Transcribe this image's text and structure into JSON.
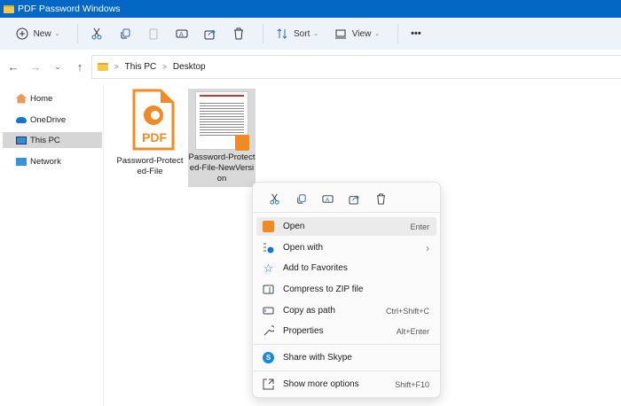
{
  "window": {
    "title": "PDF Password Windows"
  },
  "toolbar": {
    "new_label": "New",
    "sort_label": "Sort",
    "view_label": "View",
    "more": "•••"
  },
  "address": {
    "crumbs": [
      "This PC",
      "Desktop"
    ],
    "sep": ">"
  },
  "sidebar": {
    "items": [
      {
        "label": "Home"
      },
      {
        "label": "OneDrive"
      },
      {
        "label": "This PC"
      },
      {
        "label": "Network"
      }
    ]
  },
  "files": [
    {
      "name": "Password-Protected-File",
      "line1": "Password-Protect",
      "line2": "ed-File",
      "line3": ""
    },
    {
      "name": "Password-Protected-File-NewVersion",
      "line1": "Password-Protect",
      "line2": "ed-File-NewVersi",
      "line3": "on"
    }
  ],
  "file_icon_text": "PDF",
  "context_menu": {
    "items": [
      {
        "label": "Open",
        "shortcut": "Enter"
      },
      {
        "label": "Open with",
        "shortcut": "›"
      },
      {
        "label": "Add to Favorites",
        "shortcut": ""
      },
      {
        "label": "Compress to ZIP file",
        "shortcut": ""
      },
      {
        "label": "Copy as path",
        "shortcut": "Ctrl+Shift+C"
      },
      {
        "label": "Properties",
        "shortcut": "Alt+Enter"
      },
      {
        "label": "Share with Skype",
        "shortcut": ""
      },
      {
        "label": "Show more options",
        "shortcut": "Shift+F10"
      }
    ]
  },
  "colors": {
    "titlebar": "#0467c4",
    "foxit": "#f08a24"
  }
}
